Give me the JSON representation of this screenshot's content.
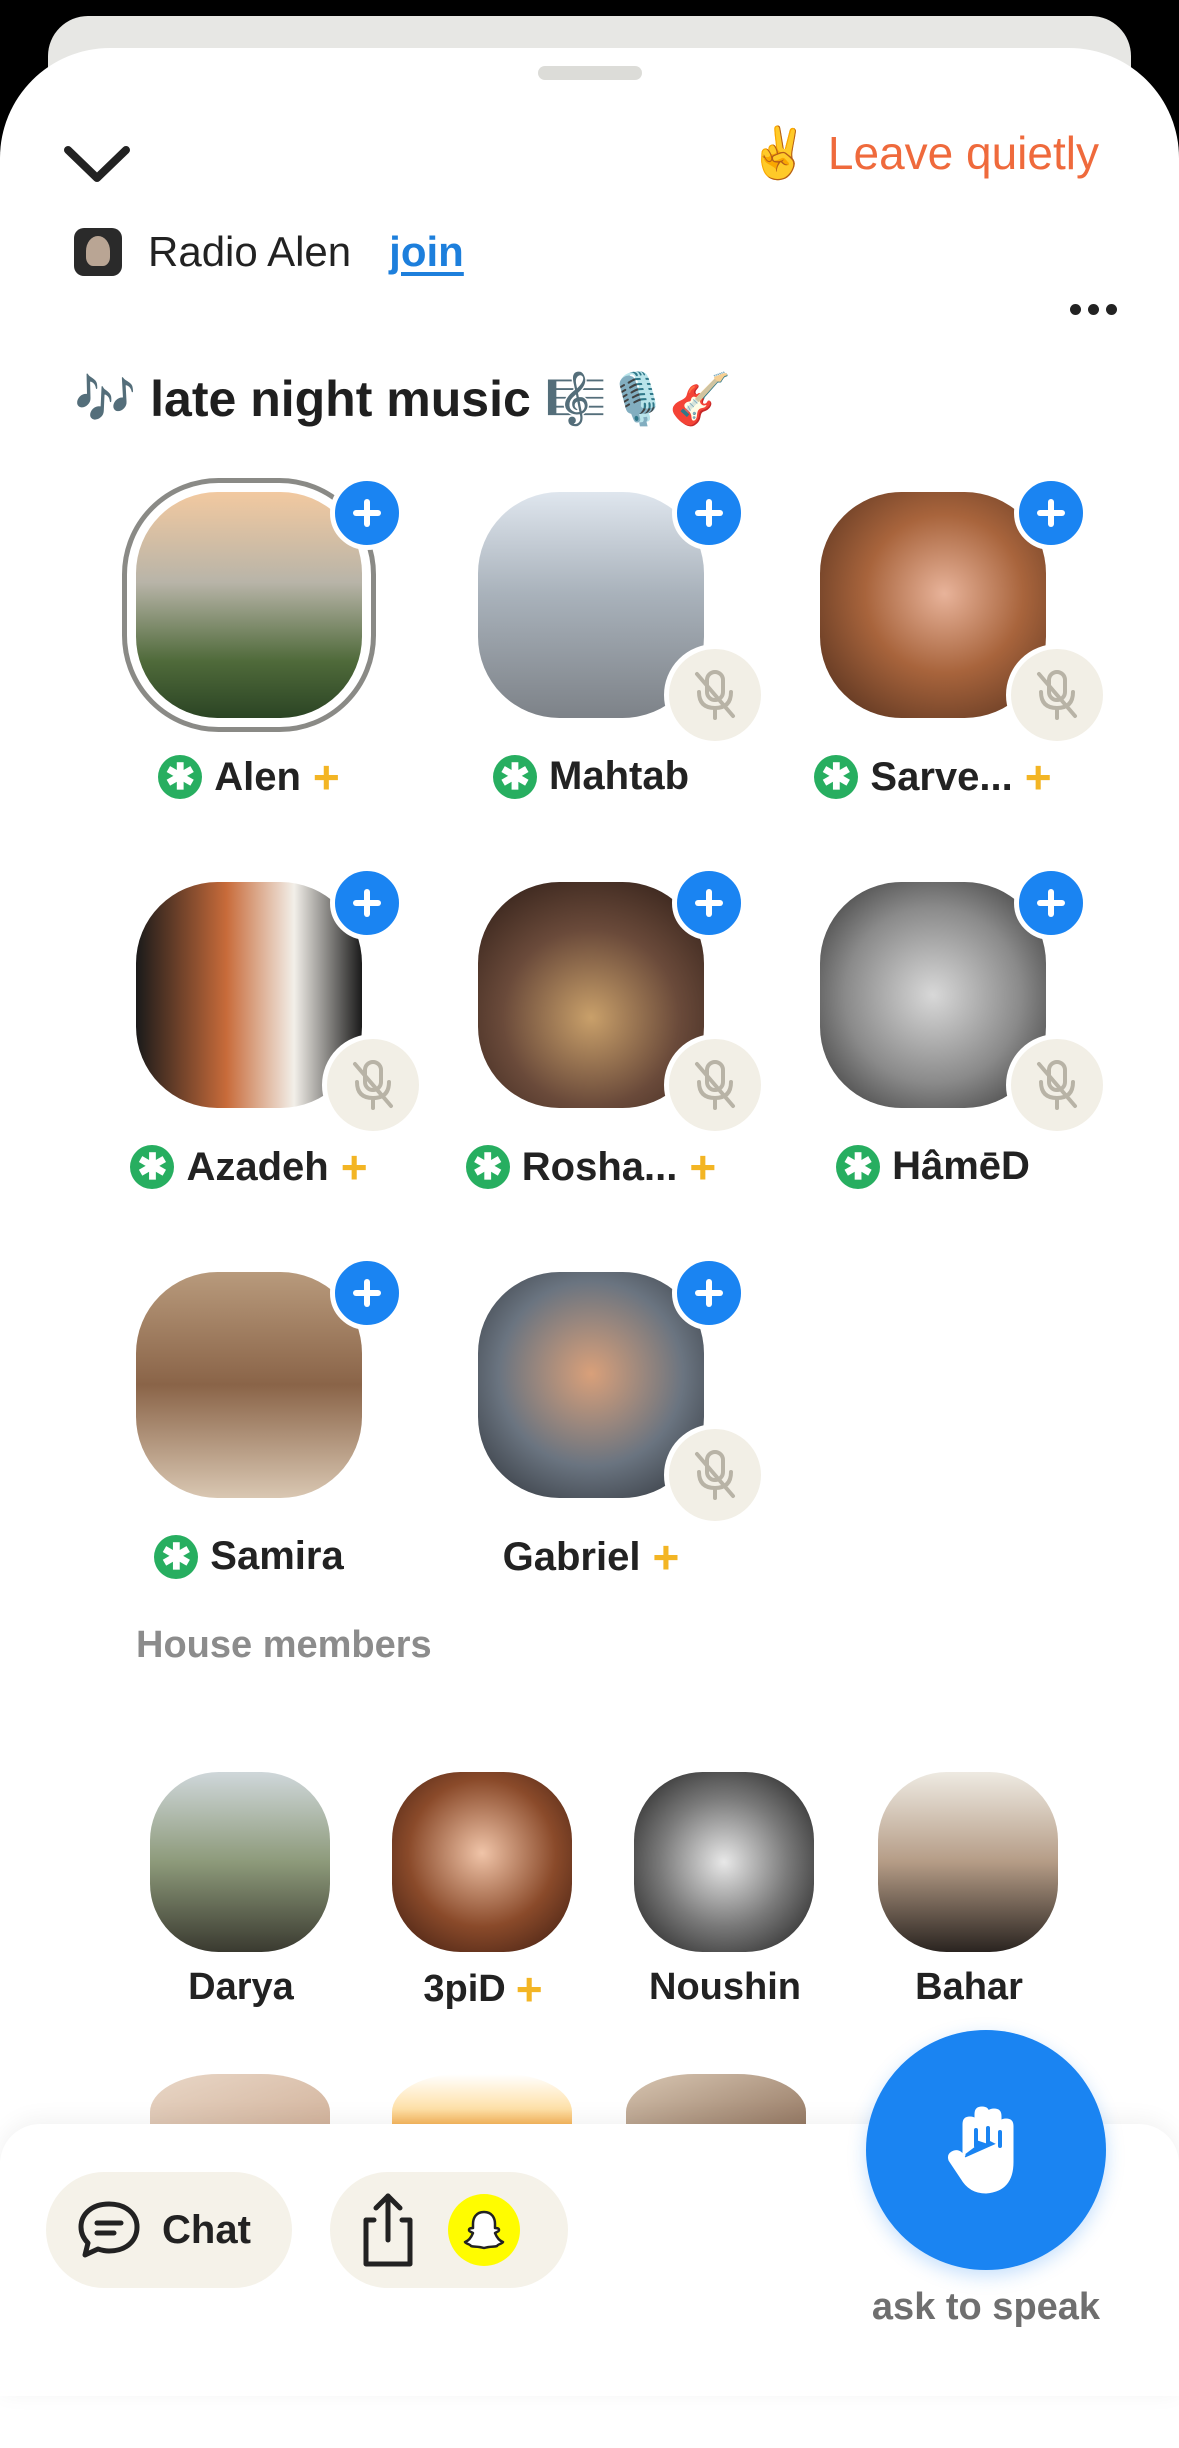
{
  "header": {
    "leave_emoji": "✌️",
    "leave_label": "Leave quietly"
  },
  "club": {
    "name": "Radio Alen",
    "join_label": "join"
  },
  "room": {
    "title": "🎶 late night music 🎼🎙️🎸"
  },
  "speakers": [
    {
      "name": "Alen",
      "moderator": true,
      "plus": true,
      "muted": false,
      "speaking": true
    },
    {
      "name": "Mahtab",
      "moderator": true,
      "plus": false,
      "muted": true,
      "speaking": false
    },
    {
      "name": "Sarve...",
      "moderator": true,
      "plus": true,
      "muted": true,
      "speaking": false
    },
    {
      "name": "Azadeh",
      "moderator": true,
      "plus": true,
      "muted": true,
      "speaking": false
    },
    {
      "name": "Rosha...",
      "moderator": true,
      "plus": true,
      "muted": true,
      "speaking": false
    },
    {
      "name": "HâmēD",
      "moderator": true,
      "plus": false,
      "muted": true,
      "speaking": false
    },
    {
      "name": "Samira",
      "moderator": true,
      "plus": false,
      "muted": false,
      "speaking": false
    },
    {
      "name": "Gabriel",
      "moderator": false,
      "plus": true,
      "muted": true,
      "speaking": false
    }
  ],
  "house_members": {
    "title": "House members",
    "members": [
      {
        "name": "Darya",
        "plus": false
      },
      {
        "name": "3piD",
        "plus": true
      },
      {
        "name": "Noushin",
        "plus": false
      },
      {
        "name": "Bahar",
        "plus": false
      }
    ]
  },
  "badges": {
    "moderator_symbol": "✱",
    "plus_symbol": "+"
  },
  "bottom": {
    "chat_label": "Chat",
    "ask_label": "ask to speak"
  },
  "colors": {
    "accent_blue": "#1a84f2",
    "leave_orange": "#ef6a3c",
    "moderator_green": "#27ae60",
    "plus_gold": "#f3b524",
    "pill_bg": "#f5f2e9"
  }
}
